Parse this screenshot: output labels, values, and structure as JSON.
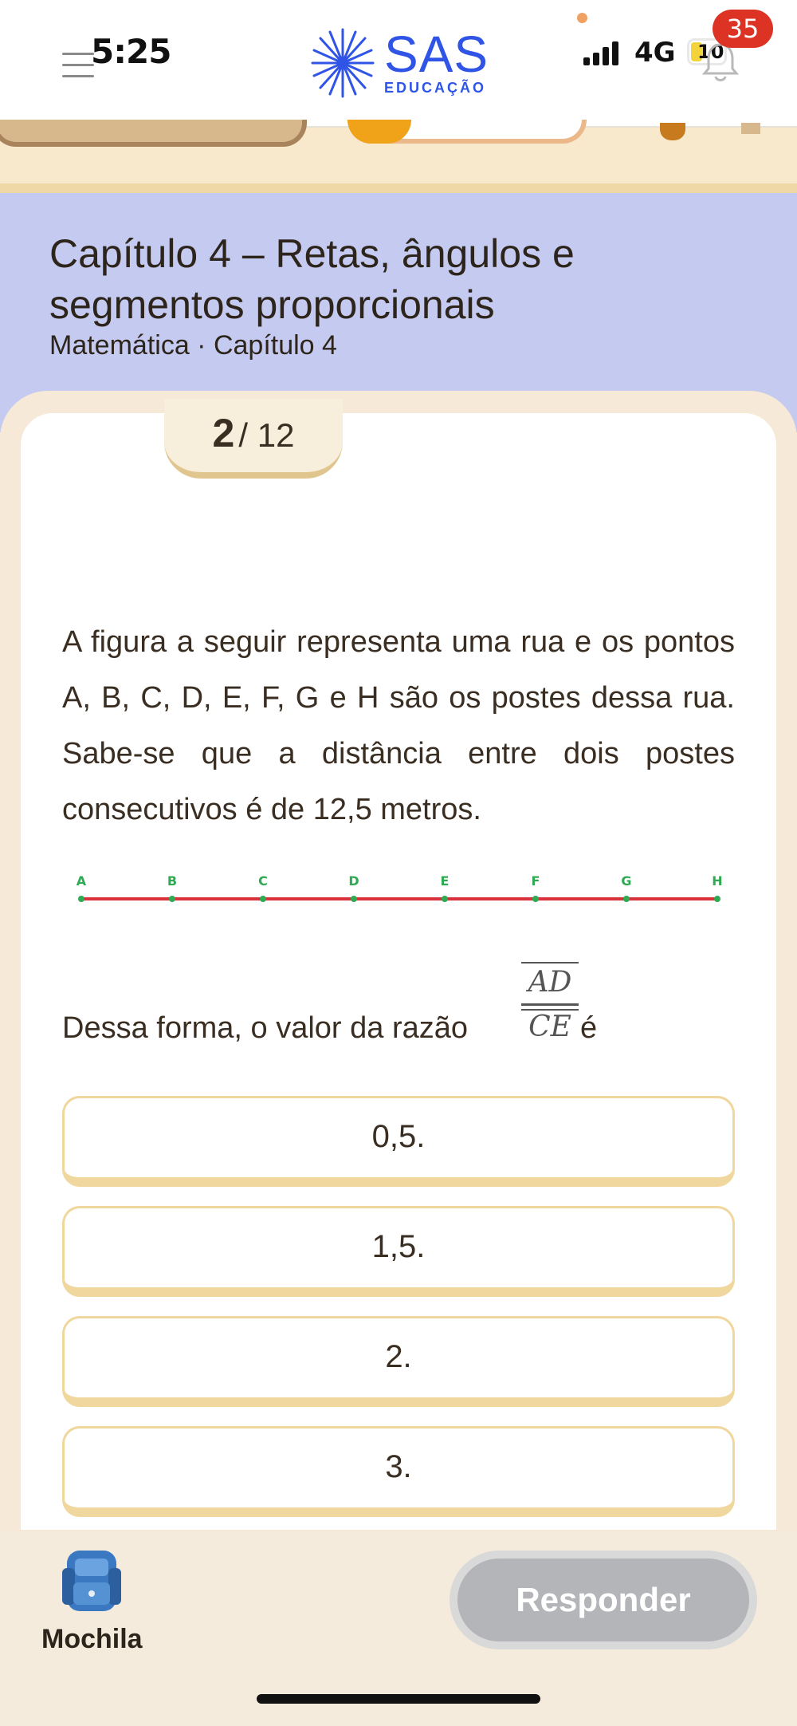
{
  "status": {
    "time": "5:25",
    "network": "4G",
    "battery": "10",
    "notifications": "35"
  },
  "brand": {
    "name": "SAS",
    "sub": "EDUCAÇÃO",
    "color": "#2f54e6"
  },
  "chapter": {
    "title": "Capítulo 4 – Retas, ângulos e segmentos proporcionais",
    "subtitle": "Matemática · Capítulo 4"
  },
  "progress": {
    "current": "2",
    "separator_total": "/ 12"
  },
  "question": {
    "text": "A figura a seguir representa uma rua e os pontos A, B, C, D, E, F, G e H são os postes dessa rua. Sabe-se que a distância entre dois postes consecutivos é de 12,5 metros.",
    "points": [
      "A",
      "B",
      "C",
      "D",
      "E",
      "F",
      "G",
      "H"
    ],
    "ratio_prefix": "Dessa forma, o valor da razão",
    "ratio_numerator": "AD",
    "ratio_denominator": "CE",
    "ratio_suffix": "é"
  },
  "options": [
    "0,5.",
    "1,5.",
    "2.",
    "3."
  ],
  "bottom": {
    "bag_label": "Mochila",
    "respond_label": "Responder"
  },
  "colors": {
    "line": "#d9323c",
    "points": "#2faa52",
    "accent": "#f0d79e",
    "header_bg": "#c5cbf0"
  }
}
